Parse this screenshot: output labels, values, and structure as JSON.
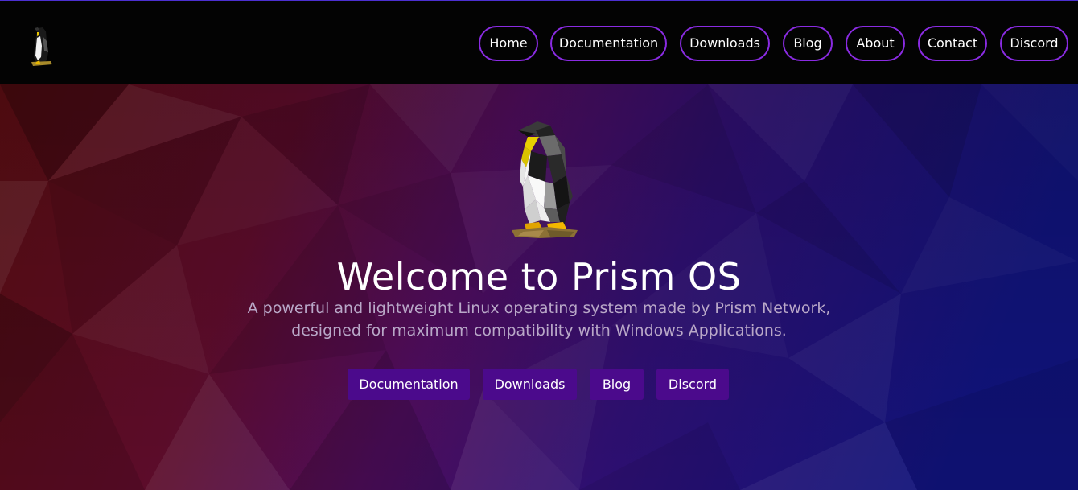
{
  "nav": {
    "links": [
      "Home",
      "Documentation",
      "Downloads",
      "Blog",
      "About",
      "Contact",
      "Discord"
    ]
  },
  "hero": {
    "title": "Welcome to Prism OS",
    "subtitle_line1": "A powerful and lightweight Linux operating system made by Prism Network,",
    "subtitle_line2": "designed for maximum compatibility with Windows Applications.",
    "buttons": [
      "Documentation",
      "Downloads",
      "Blog",
      "Discord"
    ]
  },
  "icons": {
    "logo": "penguin-icon",
    "hero_image": "penguin-icon"
  },
  "colors": {
    "nav_bg": "#030303",
    "nav_border": "#8a2be2",
    "button_bg": "#4b0a8c",
    "hero_left": "#5a0d12",
    "hero_mid": "#4e0d5c",
    "hero_right": "#10137a"
  }
}
